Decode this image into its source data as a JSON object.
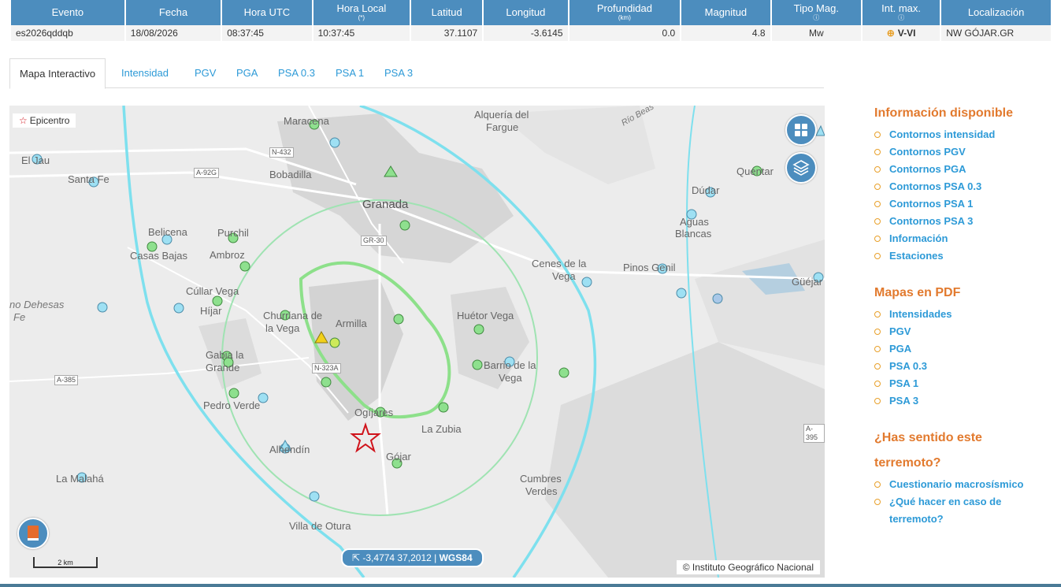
{
  "table": {
    "headers": [
      {
        "label": "Evento",
        "sub": ""
      },
      {
        "label": "Fecha",
        "sub": ""
      },
      {
        "label": "Hora UTC",
        "sub": ""
      },
      {
        "label": "Hora Local",
        "sub": "(*)"
      },
      {
        "label": "Latitud",
        "sub": ""
      },
      {
        "label": "Longitud",
        "sub": ""
      },
      {
        "label": "Profundidad",
        "sub": "(km)"
      },
      {
        "label": "Magnitud",
        "sub": ""
      },
      {
        "label": "Tipo Mag.",
        "sub": "ⓘ"
      },
      {
        "label": "Int. max.",
        "sub": "ⓘ"
      },
      {
        "label": "Localización",
        "sub": ""
      }
    ],
    "row": {
      "evento": "es2026qddqb",
      "fecha": "18/08/2026",
      "hora_utc": "08:37:45",
      "hora_local": "10:37:45",
      "latitud": "37.1107",
      "longitud": "-3.6145",
      "profundidad": "0.0",
      "magnitud": "4.8",
      "tipo_mag": "Mw",
      "int_max": "V-VI",
      "localizacion": "NW GÓJAR.GR"
    }
  },
  "tabs": [
    "Mapa Interactivo",
    "Intensidad",
    "PGV",
    "PGA",
    "PSA 0.3",
    "PSA 1",
    "PSA 3"
  ],
  "map": {
    "legend": "Epicentro",
    "coords_text": "-3,4774   37,2012 |",
    "crs": "WGS84",
    "attribution": "© Instituto Geográfico Nacional",
    "scale": "2 km",
    "places": [
      "Maracena",
      "Alquería del",
      "Fargue",
      "Bobadilla",
      "Granada",
      "El Jau",
      "Santa Fe",
      "Belicena",
      "Casas Bajas",
      "Purchil",
      "Ambroz",
      "Cúllar Vega",
      "Híjar",
      "Churriana de",
      "la Vega",
      "Armilla",
      "Huétor Vega",
      "Gabia la",
      "Grande",
      "Barrio de la",
      "Vega",
      "Pedro Verde",
      "Ogíjares",
      "La Zubia",
      "Alhendín",
      "Gójar",
      "La Malahá",
      "Villa de Otura",
      "Cumbres",
      "Verdes",
      "Quéntar",
      "Dúdar",
      "Aguas",
      "Blancas",
      "Cenes de la",
      "Vega",
      "Pinos Genil",
      "Güéjar",
      "no Dehesas",
      "Fe",
      "Río Beas"
    ],
    "roads": [
      "N-432",
      "A-92G",
      "GR-30",
      "N-323A",
      "A-385",
      "A-395"
    ]
  },
  "sidebar": {
    "info_title": "Información disponible",
    "info_items": [
      "Contornos intensidad",
      "Contornos PGV",
      "Contornos PGA",
      "Contornos PSA 0.3",
      "Contornos PSA 1",
      "Contornos PSA 3",
      "Información",
      "Estaciones"
    ],
    "pdf_title": "Mapas en PDF",
    "pdf_items": [
      "Intensidades",
      "PGV",
      "PGA",
      "PSA 0.3",
      "PSA 1",
      "PSA 3"
    ],
    "felt_title_1": "¿Has sentido este",
    "felt_title_2": "terremoto?",
    "felt_items": [
      "Cuestionario macrosísmico",
      "¿Qué hacer en caso de terremoto?"
    ]
  },
  "colors": {
    "header_blue": "#4c8dbe",
    "link_blue": "#2d9ad7",
    "orange": "#e27a2e",
    "epicenter_red": "#d0131b"
  }
}
